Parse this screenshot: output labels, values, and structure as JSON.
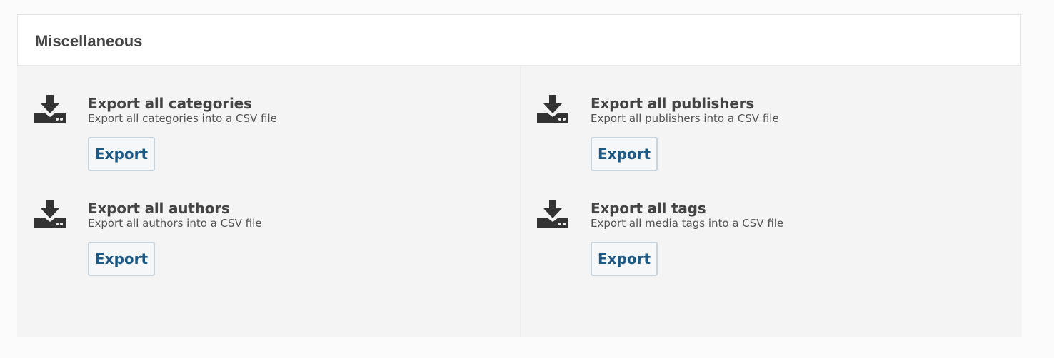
{
  "panel": {
    "title": "Miscellaneous"
  },
  "items": {
    "categories": {
      "title": "Export all categories",
      "description": "Export all categories into a CSV file",
      "button_label": "Export",
      "icon": "download-icon"
    },
    "authors": {
      "title": "Export all authors",
      "description": "Export all authors into a CSV file",
      "button_label": "Export",
      "icon": "download-icon"
    },
    "publishers": {
      "title": "Export all publishers",
      "description": "Export all publishers into a CSV file",
      "button_label": "Export",
      "icon": "download-icon"
    },
    "tags": {
      "title": "Export all tags",
      "description": "Export all media tags into a CSV file",
      "button_label": "Export",
      "icon": "download-icon"
    }
  },
  "colors": {
    "button_text": "#1d5a86",
    "button_border": "#c9d3dc",
    "body_background": "#f4f4f4",
    "heading_text": "#444444"
  }
}
